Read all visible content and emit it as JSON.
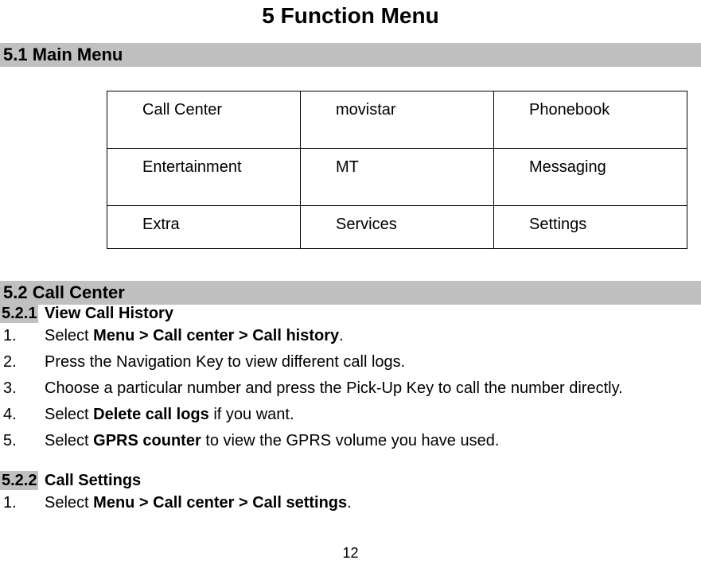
{
  "chapter": {
    "title": "5 Function Menu"
  },
  "section_5_1": {
    "heading": "5.1 Main Menu"
  },
  "menu_grid": {
    "r0": {
      "c0": "Call Center",
      "c1": "movistar",
      "c2": "Phonebook"
    },
    "r1": {
      "c0": "Entertainment",
      "c1": "MT",
      "c2": "Messaging"
    },
    "r2": {
      "c0": "Extra",
      "c1": "Services",
      "c2": "Settings"
    }
  },
  "section_5_2": {
    "heading": "5.2 Call Center",
    "sub1": {
      "num": "5.2.1",
      "title": " View Call History",
      "steps": {
        "s1n": "1.",
        "s1a": "Select ",
        "s1b": "Menu > Call center > Call history",
        "s1c": ".",
        "s2n": "2.",
        "s2a": "Press the Navigation Key to view different call logs.",
        "s3n": "3.",
        "s3a": "Choose a particular number and press the Pick-Up Key to call the number directly.",
        "s4n": "4.",
        "s4a": "Select ",
        "s4b": "Delete call logs",
        "s4c": " if you want.",
        "s5n": "5.",
        "s5a": "Select ",
        "s5b": "GPRS counter",
        "s5c": " to view the GPRS volume you have used."
      }
    },
    "sub2": {
      "num": "5.2.2",
      "title": " Call Settings",
      "steps": {
        "s1n": "1.",
        "s1a": "Select ",
        "s1b": "Menu > Call center > Call settings",
        "s1c": "."
      }
    }
  },
  "page_number": "12"
}
